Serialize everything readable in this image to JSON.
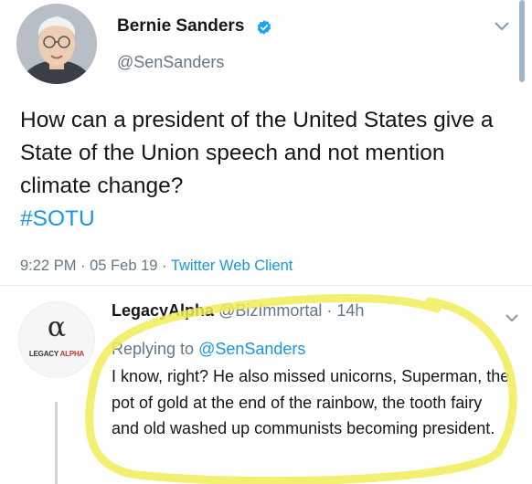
{
  "main_tweet": {
    "author_name": "Bernie Sanders",
    "handle": "@SenSanders",
    "text": "How can a president of the United States give a State of the Union speech and not mention climate change?",
    "hashtag": "#SOTU",
    "time": "9:22 PM",
    "date": "05 Feb 19",
    "client": "Twitter Web Client",
    "separator": " · "
  },
  "reply": {
    "author_name": "LegacyAlpha",
    "handle": "@BizImmortal",
    "separator": " · ",
    "time": "14h",
    "replying_prefix": "Replying to ",
    "replying_to": "@SenSanders",
    "text": "I know, right? He also missed unicorns, Superman, the pot of gold at the end of the rainbow, the tooth fairy and old washed up communists becoming president.",
    "avatar_symbol": "α",
    "avatar_brand_a": "LEGACY ",
    "avatar_brand_b": "ALPHA"
  },
  "colors": {
    "link": "#1b95e0",
    "muted": "#657786",
    "highlight": "#f3ee5a"
  },
  "icons": {
    "verified": "verified-badge-icon",
    "menu": "chevron-down-icon"
  }
}
